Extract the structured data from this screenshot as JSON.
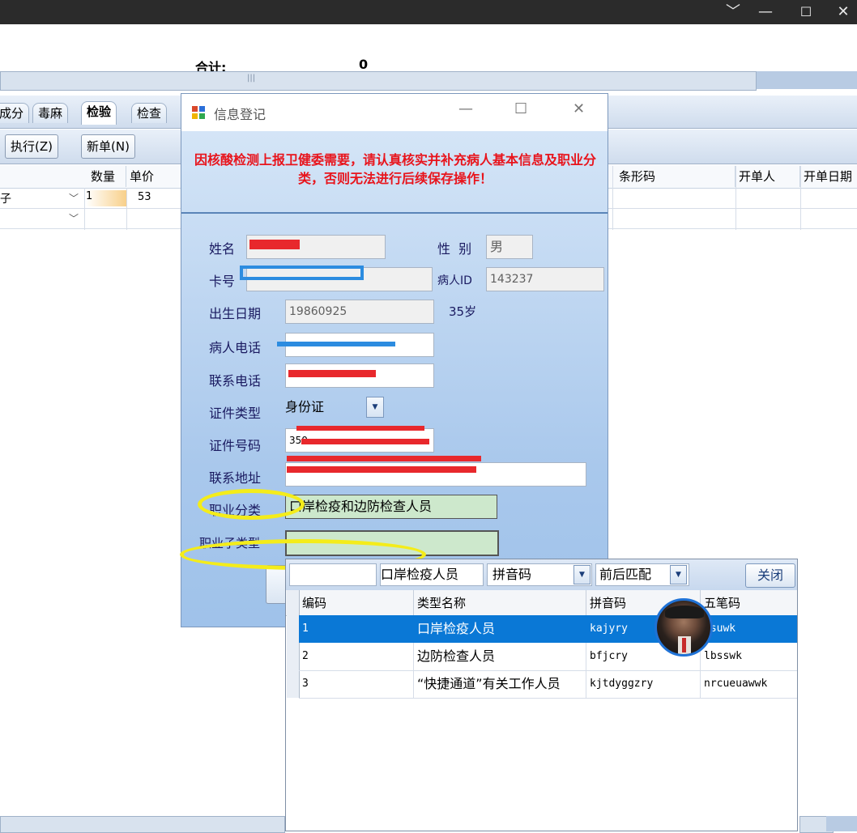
{
  "window": {
    "controls": {
      "chevron": "﹀",
      "minimize": "—",
      "maximize": "☐",
      "close": "✕"
    }
  },
  "background_app": {
    "total_label": "合计:",
    "total_value": "0",
    "scroll_grip": "|||",
    "tabs": [
      "成分",
      "毒麻",
      "检验",
      "检查"
    ],
    "active_tab": "检验",
    "toolbar": {
      "execute": "执行(Z)",
      "new_order": "新单(N)"
    },
    "grid_headers": {
      "qty": "数量",
      "price": "单价",
      "barcode": "条形码",
      "issuer": "开单人",
      "issue_date": "开单日期"
    },
    "row1": {
      "name_tail": "子",
      "qty": "1",
      "price": "53"
    }
  },
  "dialog": {
    "title": "信息登记",
    "warning": "因核酸检测上报卫健委需要，请认真核实并补充病人基本信息及职业分类，否则无法进行后续保存操作！",
    "labels": {
      "name": "姓名",
      "sex": "性  别",
      "card": "卡号",
      "patient_id": "病人ID",
      "birth": "出生日期",
      "phone": "病人电话",
      "contact_phone": "联系电话",
      "id_type": "证件类型",
      "id_no": "证件号码",
      "address": "联系地址",
      "occupation": "职业分类",
      "occupation_sub": "职业子类型"
    },
    "values": {
      "sex": "男",
      "patient_id": "143237",
      "birth": "19860925",
      "age": "35岁",
      "id_type": "身份证",
      "id_no_prefix": "350",
      "occupation": "口岸检疫和边防检查人员",
      "occupation_sub": ""
    }
  },
  "popup": {
    "search_value": "",
    "type_value": "口岸检疫人员",
    "field_select": "拼音码",
    "match_select": "前后匹配",
    "close_label": "关闭",
    "columns": [
      "编码",
      "类型名称",
      "拼音码",
      "五笔码"
    ],
    "rows": [
      {
        "code": "1",
        "name": "口岸检疫人员",
        "py": "kajyry",
        "wb": "ksuwk"
      },
      {
        "code": "2",
        "name": "边防检查人员",
        "py": "bfjcry",
        "wb": "lbsswk"
      },
      {
        "code": "3",
        "name": "“快捷通道”有关工作人员",
        "py": "kjtdyggzry",
        "wb": "nrcueuawwk"
      }
    ],
    "selected_row": 1
  },
  "colors": {
    "warning_text": "#e8141c",
    "selected_row": "#0a78d6",
    "highlight_ellipse": "#f4ec1a"
  }
}
